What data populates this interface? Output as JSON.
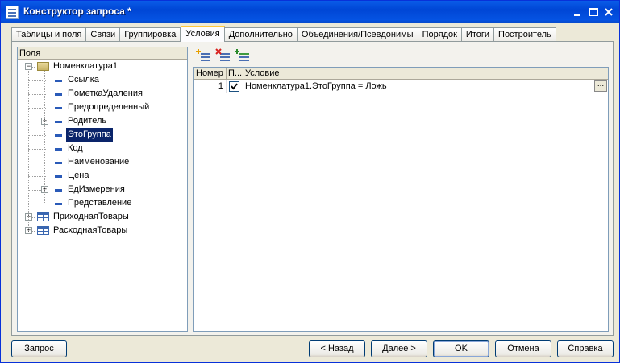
{
  "window": {
    "title": "Конструктор запроса *"
  },
  "tabs": [
    {
      "label": "Таблицы и поля"
    },
    {
      "label": "Связи"
    },
    {
      "label": "Группировка"
    },
    {
      "label": "Условия",
      "active": true
    },
    {
      "label": "Дополнительно"
    },
    {
      "label": "Объединения/Псевдонимы"
    },
    {
      "label": "Порядок"
    },
    {
      "label": "Итоги"
    },
    {
      "label": "Построитель"
    }
  ],
  "fields_pane": {
    "header": "Поля",
    "tree": [
      {
        "label": "Номенклатура1",
        "level": 0,
        "type": "folder",
        "expanded": true
      },
      {
        "label": "Ссылка",
        "level": 1,
        "type": "field"
      },
      {
        "label": "ПометкаУдаления",
        "level": 1,
        "type": "field"
      },
      {
        "label": "Предопределенный",
        "level": 1,
        "type": "field"
      },
      {
        "label": "Родитель",
        "level": 1,
        "type": "field",
        "collapsed": true
      },
      {
        "label": "ЭтоГруппа",
        "level": 1,
        "type": "field",
        "selected": true
      },
      {
        "label": "Код",
        "level": 1,
        "type": "field"
      },
      {
        "label": "Наименование",
        "level": 1,
        "type": "field"
      },
      {
        "label": "Цена",
        "level": 1,
        "type": "field"
      },
      {
        "label": "ЕдИзмерения",
        "level": 1,
        "type": "field",
        "collapsed": true
      },
      {
        "label": "Представление",
        "level": 1,
        "type": "field"
      },
      {
        "label": "ПриходнаяТовары",
        "level": 0,
        "type": "table",
        "collapsed": true
      },
      {
        "label": "РасходнаяТовары",
        "level": 0,
        "type": "table",
        "collapsed": true
      }
    ]
  },
  "conditions": {
    "toolbar": [
      {
        "icon": "add-condition-icon"
      },
      {
        "icon": "delete-condition-icon"
      },
      {
        "icon": "add-arbitrary-condition-icon"
      }
    ],
    "columns": [
      "Номер",
      "П...",
      "Условие"
    ],
    "rows": [
      {
        "number": "1",
        "checked": true,
        "condition": "Номенклатура1.ЭтоГруппа = Ложь"
      }
    ],
    "ellipsis": "..."
  },
  "buttons": {
    "query": "Запрос",
    "back": "< Назад",
    "next": "Далее >",
    "ok": "OK",
    "cancel": "Отмена",
    "help": "Справка"
  }
}
